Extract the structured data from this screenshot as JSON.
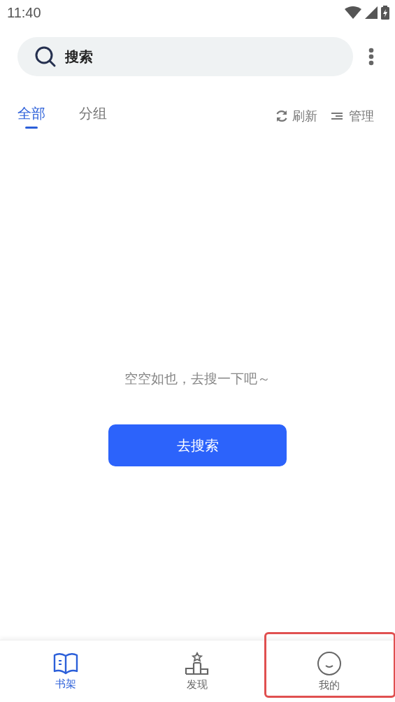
{
  "status_bar": {
    "time": "11:40"
  },
  "search": {
    "placeholder": "搜索"
  },
  "tabs": [
    {
      "label": "全部",
      "selected": true
    },
    {
      "label": "分组",
      "selected": false
    }
  ],
  "actions": [
    {
      "kind": "refresh",
      "label": "刷新"
    },
    {
      "kind": "manage",
      "label": "管理"
    }
  ],
  "empty_state": {
    "message": "空空如也，去搜一下吧～",
    "button": "去搜索"
  },
  "bottom_nav": [
    {
      "kind": "shelf",
      "label": "书架",
      "selected": true,
      "highlighted": false
    },
    {
      "kind": "discover",
      "label": "发现",
      "selected": false,
      "highlighted": false
    },
    {
      "kind": "profile",
      "label": "我的",
      "selected": false,
      "highlighted": true
    }
  ]
}
